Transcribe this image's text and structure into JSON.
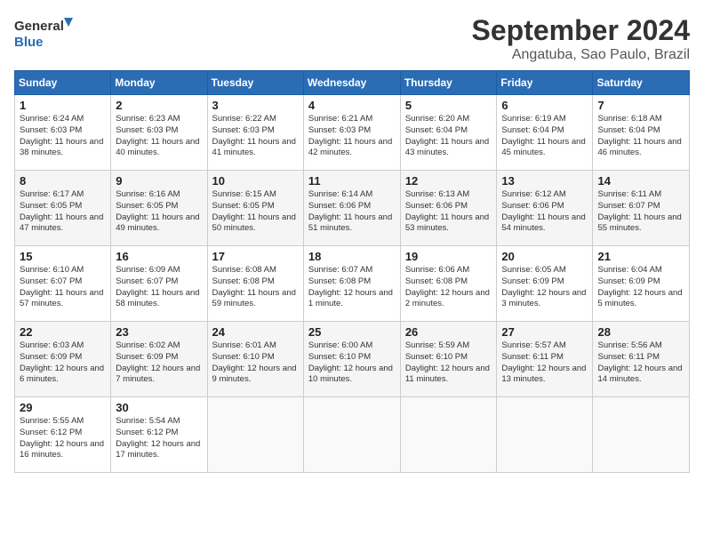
{
  "header": {
    "logo": {
      "general": "General",
      "blue": "Blue"
    },
    "title": "September 2024",
    "location": "Angatuba, Sao Paulo, Brazil"
  },
  "calendar": {
    "days_of_week": [
      "Sunday",
      "Monday",
      "Tuesday",
      "Wednesday",
      "Thursday",
      "Friday",
      "Saturday"
    ],
    "weeks": [
      [
        {
          "day": "1",
          "sunrise": "6:24 AM",
          "sunset": "6:03 PM",
          "daylight": "11 hours and 38 minutes."
        },
        {
          "day": "2",
          "sunrise": "6:23 AM",
          "sunset": "6:03 PM",
          "daylight": "11 hours and 40 minutes."
        },
        {
          "day": "3",
          "sunrise": "6:22 AM",
          "sunset": "6:03 PM",
          "daylight": "11 hours and 41 minutes."
        },
        {
          "day": "4",
          "sunrise": "6:21 AM",
          "sunset": "6:03 PM",
          "daylight": "11 hours and 42 minutes."
        },
        {
          "day": "5",
          "sunrise": "6:20 AM",
          "sunset": "6:04 PM",
          "daylight": "11 hours and 43 minutes."
        },
        {
          "day": "6",
          "sunrise": "6:19 AM",
          "sunset": "6:04 PM",
          "daylight": "11 hours and 45 minutes."
        },
        {
          "day": "7",
          "sunrise": "6:18 AM",
          "sunset": "6:04 PM",
          "daylight": "11 hours and 46 minutes."
        }
      ],
      [
        {
          "day": "8",
          "sunrise": "6:17 AM",
          "sunset": "6:05 PM",
          "daylight": "11 hours and 47 minutes."
        },
        {
          "day": "9",
          "sunrise": "6:16 AM",
          "sunset": "6:05 PM",
          "daylight": "11 hours and 49 minutes."
        },
        {
          "day": "10",
          "sunrise": "6:15 AM",
          "sunset": "6:05 PM",
          "daylight": "11 hours and 50 minutes."
        },
        {
          "day": "11",
          "sunrise": "6:14 AM",
          "sunset": "6:06 PM",
          "daylight": "11 hours and 51 minutes."
        },
        {
          "day": "12",
          "sunrise": "6:13 AM",
          "sunset": "6:06 PM",
          "daylight": "11 hours and 53 minutes."
        },
        {
          "day": "13",
          "sunrise": "6:12 AM",
          "sunset": "6:06 PM",
          "daylight": "11 hours and 54 minutes."
        },
        {
          "day": "14",
          "sunrise": "6:11 AM",
          "sunset": "6:07 PM",
          "daylight": "11 hours and 55 minutes."
        }
      ],
      [
        {
          "day": "15",
          "sunrise": "6:10 AM",
          "sunset": "6:07 PM",
          "daylight": "11 hours and 57 minutes."
        },
        {
          "day": "16",
          "sunrise": "6:09 AM",
          "sunset": "6:07 PM",
          "daylight": "11 hours and 58 minutes."
        },
        {
          "day": "17",
          "sunrise": "6:08 AM",
          "sunset": "6:08 PM",
          "daylight": "11 hours and 59 minutes."
        },
        {
          "day": "18",
          "sunrise": "6:07 AM",
          "sunset": "6:08 PM",
          "daylight": "12 hours and 1 minute."
        },
        {
          "day": "19",
          "sunrise": "6:06 AM",
          "sunset": "6:08 PM",
          "daylight": "12 hours and 2 minutes."
        },
        {
          "day": "20",
          "sunrise": "6:05 AM",
          "sunset": "6:09 PM",
          "daylight": "12 hours and 3 minutes."
        },
        {
          "day": "21",
          "sunrise": "6:04 AM",
          "sunset": "6:09 PM",
          "daylight": "12 hours and 5 minutes."
        }
      ],
      [
        {
          "day": "22",
          "sunrise": "6:03 AM",
          "sunset": "6:09 PM",
          "daylight": "12 hours and 6 minutes."
        },
        {
          "day": "23",
          "sunrise": "6:02 AM",
          "sunset": "6:09 PM",
          "daylight": "12 hours and 7 minutes."
        },
        {
          "day": "24",
          "sunrise": "6:01 AM",
          "sunset": "6:10 PM",
          "daylight": "12 hours and 9 minutes."
        },
        {
          "day": "25",
          "sunrise": "6:00 AM",
          "sunset": "6:10 PM",
          "daylight": "12 hours and 10 minutes."
        },
        {
          "day": "26",
          "sunrise": "5:59 AM",
          "sunset": "6:10 PM",
          "daylight": "12 hours and 11 minutes."
        },
        {
          "day": "27",
          "sunrise": "5:57 AM",
          "sunset": "6:11 PM",
          "daylight": "12 hours and 13 minutes."
        },
        {
          "day": "28",
          "sunrise": "5:56 AM",
          "sunset": "6:11 PM",
          "daylight": "12 hours and 14 minutes."
        }
      ],
      [
        {
          "day": "29",
          "sunrise": "5:55 AM",
          "sunset": "6:12 PM",
          "daylight": "12 hours and 16 minutes."
        },
        {
          "day": "30",
          "sunrise": "5:54 AM",
          "sunset": "6:12 PM",
          "daylight": "12 hours and 17 minutes."
        },
        null,
        null,
        null,
        null,
        null
      ]
    ]
  }
}
